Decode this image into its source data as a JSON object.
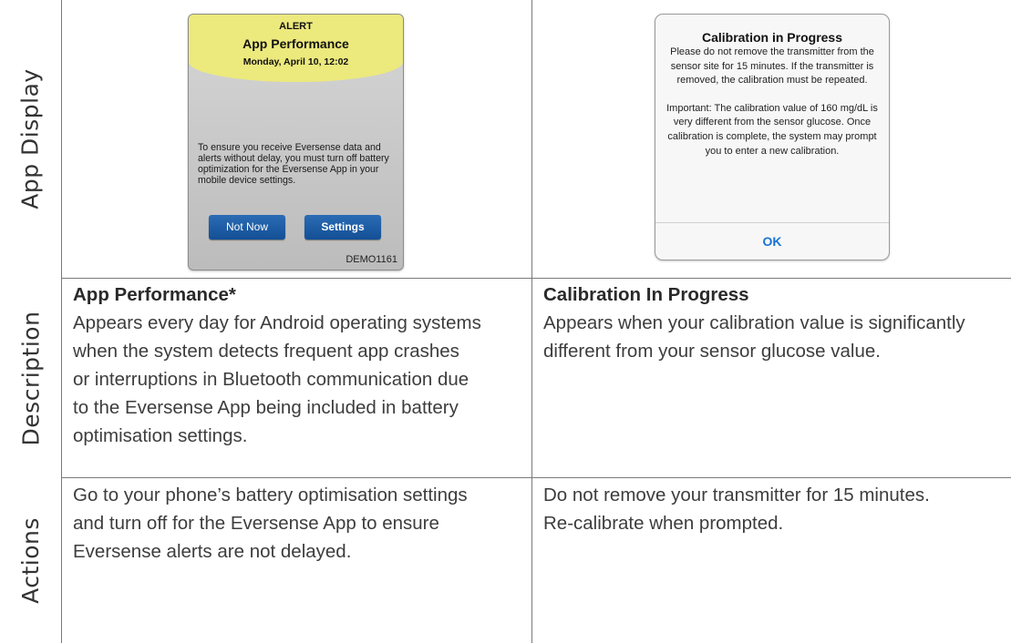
{
  "rows": {
    "app_display": "App Display",
    "description": "Description",
    "actions": "Actions"
  },
  "android_alert": {
    "tag": "ALERT",
    "title": "App Performance",
    "datetime": "Monday, April 10, 12:02",
    "message": "To ensure you receive Eversense data and alerts without delay, you must turn off battery optimization for the Eversense App in your mobile device settings.",
    "not_now_label": "Not Now",
    "settings_label": "Settings",
    "code": "DEMO1161",
    "header_color": "#ece97d",
    "button_color": "#1c5ca6"
  },
  "ios_alert": {
    "title": "Calibration in Progress",
    "body_1": "Please do not remove the transmitter from the sensor site for 15 minutes. If the transmitter is removed, the calibration must be repeated.",
    "body_2": "Important: The calibration value of 160 mg/dL is very different from the sensor glucose. Once calibration is complete, the system may prompt you to enter a new calibration.",
    "ok_label": "OK",
    "ok_color": "#1673d6"
  },
  "description": {
    "left_title": "App Performance*",
    "left_lines": [
      "Appears every day for Android operating systems",
      "when the system detects frequent app crashes",
      "or interruptions in Bluetooth communication due",
      "to the Eversense App being included in battery",
      "optimisation settings."
    ],
    "right_title": "Calibration In Progress",
    "right_lines": [
      "Appears when your calibration value is significantly",
      "different from your sensor glucose value."
    ]
  },
  "actions": {
    "left_lines": [
      "Go to your phone’s battery optimisation settings",
      "and turn off for the Eversense App to ensure",
      "Eversense alerts are not delayed."
    ],
    "right_lines": [
      "Do not remove your transmitter for 15 minutes.",
      "Re-calibrate when prompted."
    ]
  }
}
